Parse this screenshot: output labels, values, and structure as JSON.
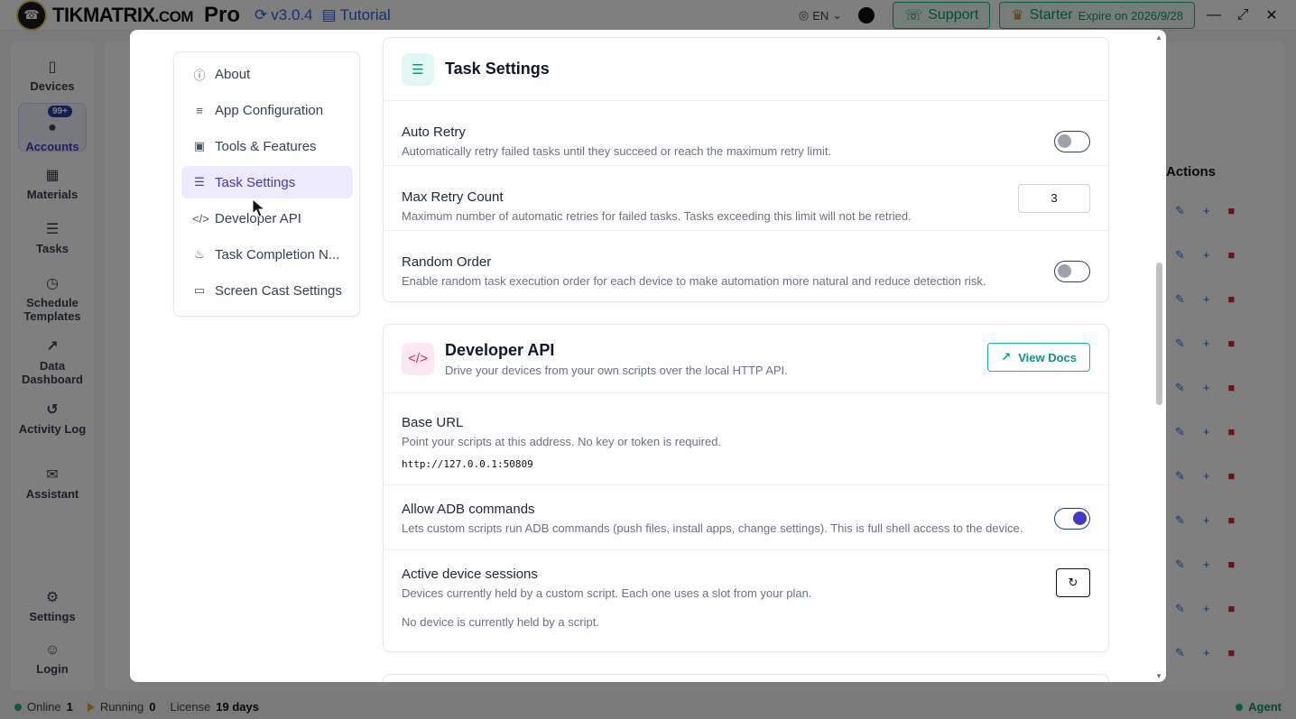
{
  "app": {
    "brand_main": "TIKMATRIX",
    "brand_suffix": ".COM",
    "brand_pro": "Pro",
    "version": "v3.0.4",
    "tutorial": "Tutorial",
    "language": "EN",
    "support": "Support",
    "plan": "Starter",
    "expire": "Expire on 2026/9/28"
  },
  "sidebar": {
    "items": [
      {
        "label": "Devices",
        "icon": "phone-icon"
      },
      {
        "label": "Accounts",
        "icon": "user-icon",
        "badge": "99+"
      },
      {
        "label": "Materials",
        "icon": "grid-icon"
      },
      {
        "label": "Tasks",
        "icon": "list-icon"
      },
      {
        "label": "Schedule Templates",
        "icon": "clock-icon"
      },
      {
        "label": "Data Dashboard",
        "icon": "chart-icon"
      },
      {
        "label": "Activity Log",
        "icon": "history-icon"
      },
      {
        "label": "Assistant",
        "icon": "chat-icon"
      },
      {
        "label": "Settings",
        "icon": "gear-icon"
      },
      {
        "label": "Login",
        "icon": "login-icon"
      }
    ]
  },
  "background": {
    "actions_header": "Actions"
  },
  "statusbar": {
    "online_label": "Online",
    "online_count": "1",
    "running_label": "Running",
    "running_count": "0",
    "license_label": "License",
    "license_value": "19 days",
    "agent": "Agent"
  },
  "settings_nav": {
    "items": [
      {
        "label": "About",
        "icon": "info-icon"
      },
      {
        "label": "App Configuration",
        "icon": "sliders-icon"
      },
      {
        "label": "Tools & Features",
        "icon": "toolbox-icon"
      },
      {
        "label": "Task Settings",
        "icon": "list-check-icon",
        "active": true
      },
      {
        "label": "Developer API",
        "icon": "code-icon"
      },
      {
        "label": "Task Completion N...",
        "icon": "bell-icon"
      },
      {
        "label": "Screen Cast Settings",
        "icon": "monitor-icon"
      }
    ]
  },
  "task_settings": {
    "title": "Task Settings",
    "auto_retry": {
      "title": "Auto Retry",
      "desc": "Automatically retry failed tasks until they succeed or reach the maximum retry limit.",
      "enabled": false
    },
    "max_retry": {
      "title": "Max Retry Count",
      "desc": "Maximum number of automatic retries for failed tasks. Tasks exceeding this limit will not be retried.",
      "value": "3"
    },
    "random_order": {
      "title": "Random Order",
      "desc": "Enable random task execution order for each device to make automation more natural and reduce detection risk.",
      "enabled": false
    }
  },
  "developer_api": {
    "title": "Developer API",
    "subtitle": "Drive your devices from your own scripts over the local HTTP API.",
    "docs_button": "View Docs",
    "base_url": {
      "title": "Base URL",
      "desc": "Point your scripts at this address. No key or token is required.",
      "value": "http://127.0.0.1:50809"
    },
    "adb": {
      "title": "Allow ADB commands",
      "desc": "Lets custom scripts run ADB commands (push files, install apps, change settings). This is full shell access to the device.",
      "enabled": true
    },
    "sessions": {
      "title": "Active device sessions",
      "desc": "Devices currently held by a custom script. Each one uses a slot from your plan.",
      "empty": "No device is currently held by a script."
    }
  },
  "colors": {
    "accent": "#4338ca",
    "teal": "#0d9488",
    "danger": "#dc2626",
    "success": "#10b981"
  }
}
